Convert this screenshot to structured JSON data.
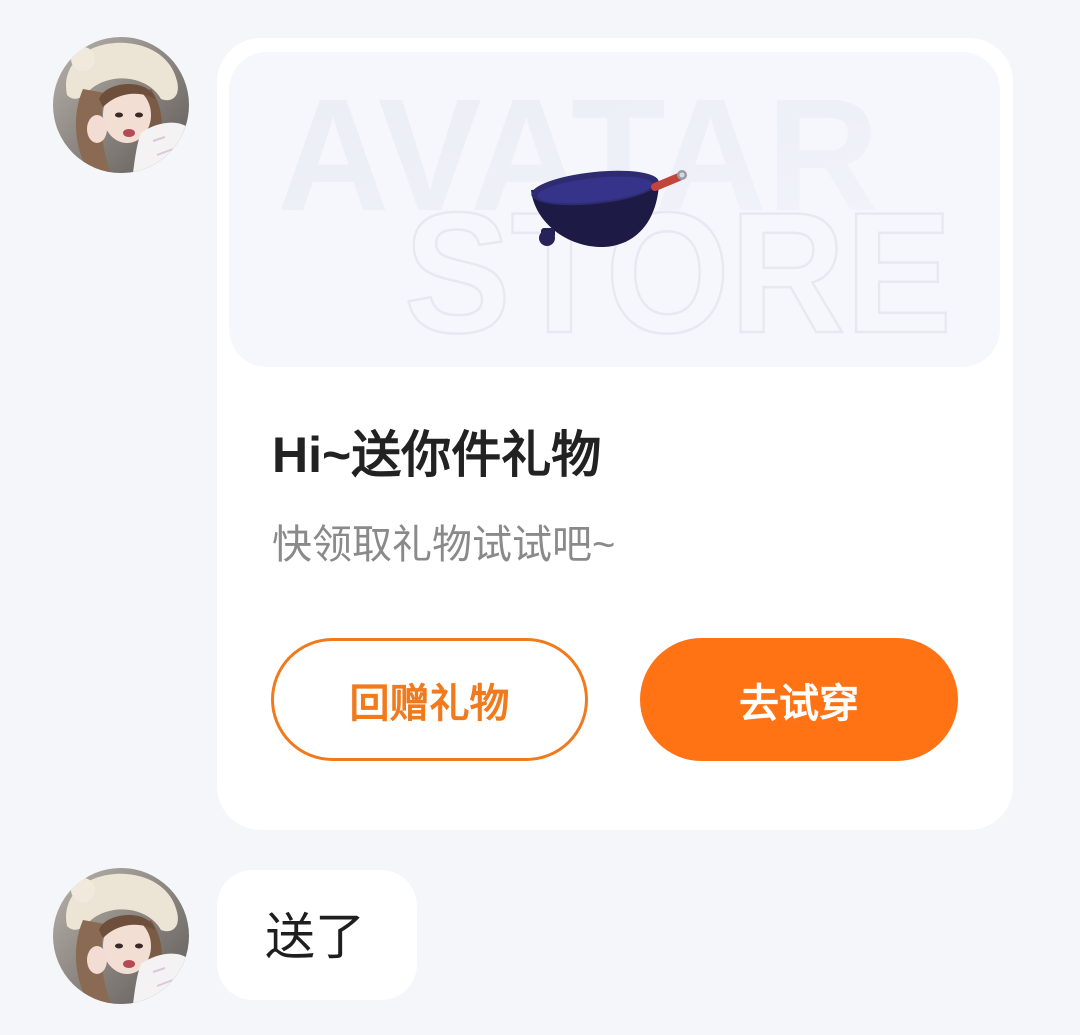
{
  "colors": {
    "background": "#f5f6fa",
    "card": "#ffffff",
    "image_panel": "#f6f7fc",
    "accent": "#ff7314",
    "accent_outline": "#f07a1c",
    "title_text": "#222222",
    "subtitle_text": "#8a8a8a",
    "message_text": "#1e1e1e"
  },
  "chat": {
    "messages": [
      {
        "avatar_icon": "user-avatar-photo",
        "card": {
          "watermark": {
            "line1": "AVATAR",
            "line2": "STORE"
          },
          "gift_item_icon": "wok-pan-icon",
          "title": "Hi~送你件礼物",
          "subtitle": "快领取礼物试试吧~",
          "return_gift_label": "回赠礼物",
          "try_on_label": "去试穿"
        }
      },
      {
        "avatar_icon": "user-avatar-photo",
        "text": "送了"
      }
    ]
  }
}
